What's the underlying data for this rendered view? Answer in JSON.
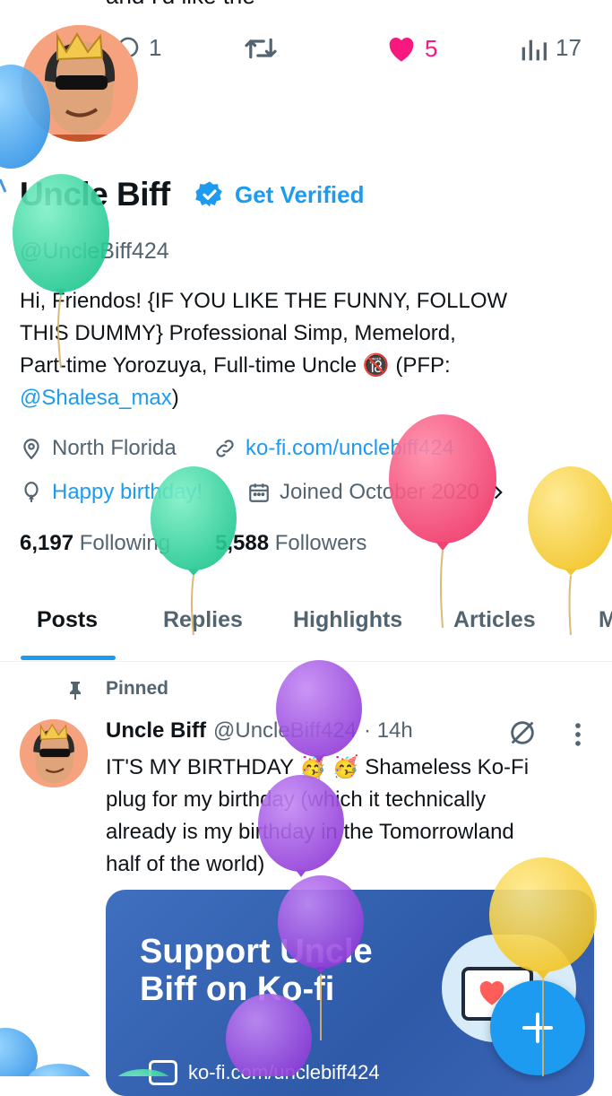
{
  "prev_tweet_tail": "and I'd like the",
  "metrics": {
    "replies": "1",
    "likes": "5",
    "views": "17"
  },
  "profile": {
    "name": "Uncle Biff",
    "get_verified": "Get Verified",
    "handle": "@UncleBiff424",
    "bio_lines": [
      "Hi, Friendos!  {IF YOU LIKE THE FUNNY, FOLLOW",
      "THIS DUMMY} Professional Simp, Memelord,",
      "Part-time Yorozuya, Full-time Uncle 🔞 (PFP:"
    ],
    "bio_mention": "@Shalesa_max",
    "bio_close": ")",
    "location": "North Florida",
    "website": "ko-fi.com/unclebiff424",
    "birthday": "Happy birthday!",
    "joined": "Joined October 2020",
    "following_count": "6,197",
    "following_label": "Following",
    "followers_count": "5,588",
    "followers_label": "Followers"
  },
  "tabs": [
    "Posts",
    "Replies",
    "Highlights",
    "Articles",
    "M"
  ],
  "pinned": {
    "label": "Pinned",
    "author": "Uncle Biff",
    "handle": "@UncleBiff424",
    "time": "· 14h",
    "text_lines": [
      "IT'S MY BIRTHDAY 🥳 🥳 Shameless Ko-Fi",
      "plug for my birthday (which it technically",
      "already is my birthday in the Tomorrowland",
      "half of the world)"
    ],
    "card_title_line1": "Support Uncle",
    "card_title_line2": "Biff on Ko-fi",
    "card_url": "ko-fi.com/unclebiff424"
  },
  "colors": {
    "accent": "#1d9bf0",
    "like": "#f91880",
    "muted": "#536471"
  }
}
